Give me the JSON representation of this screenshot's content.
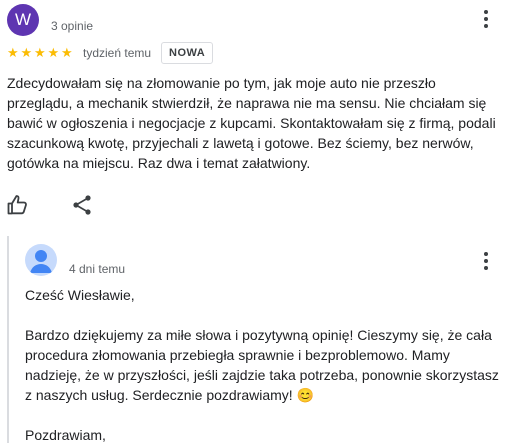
{
  "review": {
    "avatar_letter": "W",
    "avatar_color": "#5e35b1",
    "reviewer_count": "3 opinie",
    "rating": 5,
    "star_color": "#fbbc04",
    "time": "tydzień temu",
    "badge": "NOWA",
    "text": "Zdecydowałam się na złomowanie po tym, jak moje auto nie przeszło przeglądu, a mechanik stwierdził, że naprawa nie ma sensu. Nie chciałam się bawić w ogłoszenia i negocjacje z kupcami. Skontaktowałam się z firmą, podali szacunkową kwotę, przyjechali z lawetą i gotowe. Bez ściemy, bez nerwów, gotówka na miejscu. Raz dwa i temat załatwiony.",
    "icons": {
      "like": "thumb-up-icon",
      "share": "share-icon",
      "menu": "more-vert-icon"
    }
  },
  "reply": {
    "time": "4 dni temu",
    "greeting": "Cześć Wiesławie,",
    "body": "Bardzo dziękujemy za miłe słowa i pozytywną opinię! Cieszymy się, że cała procedura złomowania przebiegła sprawnie i bezproblemowo. Mamy nadzieję, że w przyszłości, jeśli zajdzie taka potrzeba, ponownie skorzystasz z naszych usług. Serdecznie pozdrawiamy! 😊",
    "closing": "Pozdrawiam,",
    "icons": {
      "avatar": "person-icon",
      "menu": "more-vert-icon"
    }
  }
}
